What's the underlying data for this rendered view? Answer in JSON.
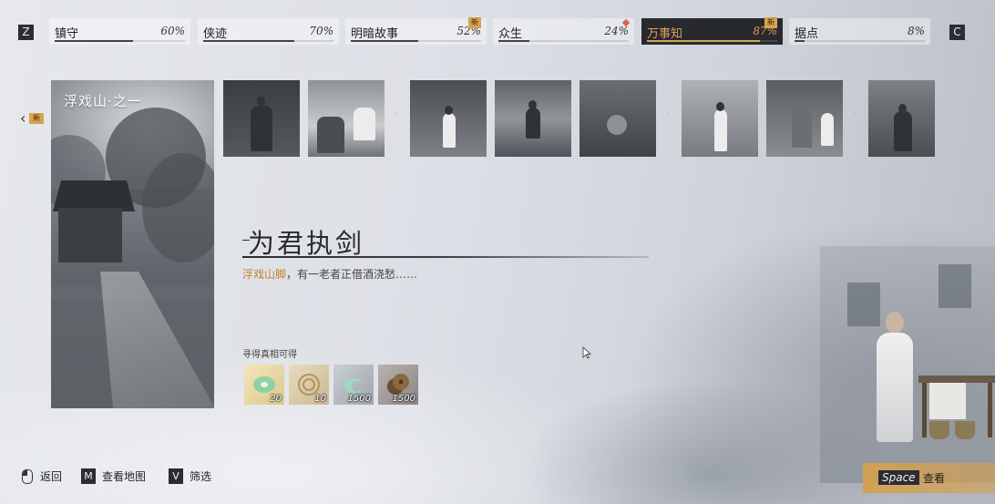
{
  "tabs": {
    "prev_key": "Z",
    "next_key": "C",
    "items": [
      {
        "label": "镇守",
        "percent": "60%",
        "progress": 0.6,
        "new": false,
        "dot": false,
        "active": false
      },
      {
        "label": "侠迹",
        "percent": "70%",
        "progress": 0.7,
        "new": false,
        "dot": false,
        "active": false
      },
      {
        "label": "明暗故事",
        "percent": "52%",
        "progress": 0.52,
        "new": true,
        "dot": false,
        "active": false
      },
      {
        "label": "众生",
        "percent": "24%",
        "progress": 0.24,
        "new": false,
        "dot": true,
        "active": false
      },
      {
        "label": "万事知",
        "percent": "87%",
        "progress": 0.87,
        "new": true,
        "dot": false,
        "active": true
      },
      {
        "label": "据点",
        "percent": "8%",
        "progress": 0.08,
        "new": false,
        "dot": false,
        "active": false
      }
    ],
    "new_label": "新"
  },
  "left_nav": {
    "new_label": "新"
  },
  "card": {
    "title": "浮戏山·之一"
  },
  "story": {
    "title": "为君执剑",
    "location": "浮戏山脚",
    "description": "，有一老者正借酒浇愁……"
  },
  "rewards": {
    "label": "寻得真相可得",
    "items": [
      {
        "name": "jade-pendant",
        "qty": "20"
      },
      {
        "name": "scroll-token",
        "qty": "10"
      },
      {
        "name": "jade-swirl",
        "qty": "1500"
      },
      {
        "name": "copper-coins",
        "qty": "1500"
      }
    ]
  },
  "hints": {
    "back": {
      "label": "返回"
    },
    "map": {
      "key": "M",
      "label": "查看地图"
    },
    "filter": {
      "key": "V",
      "label": "筛选"
    },
    "view": {
      "key": "Space",
      "label": "查看"
    }
  },
  "colors": {
    "accent": "#d8a35c",
    "location_text": "#c47f2d",
    "active_tab_bg": "#27292d"
  }
}
